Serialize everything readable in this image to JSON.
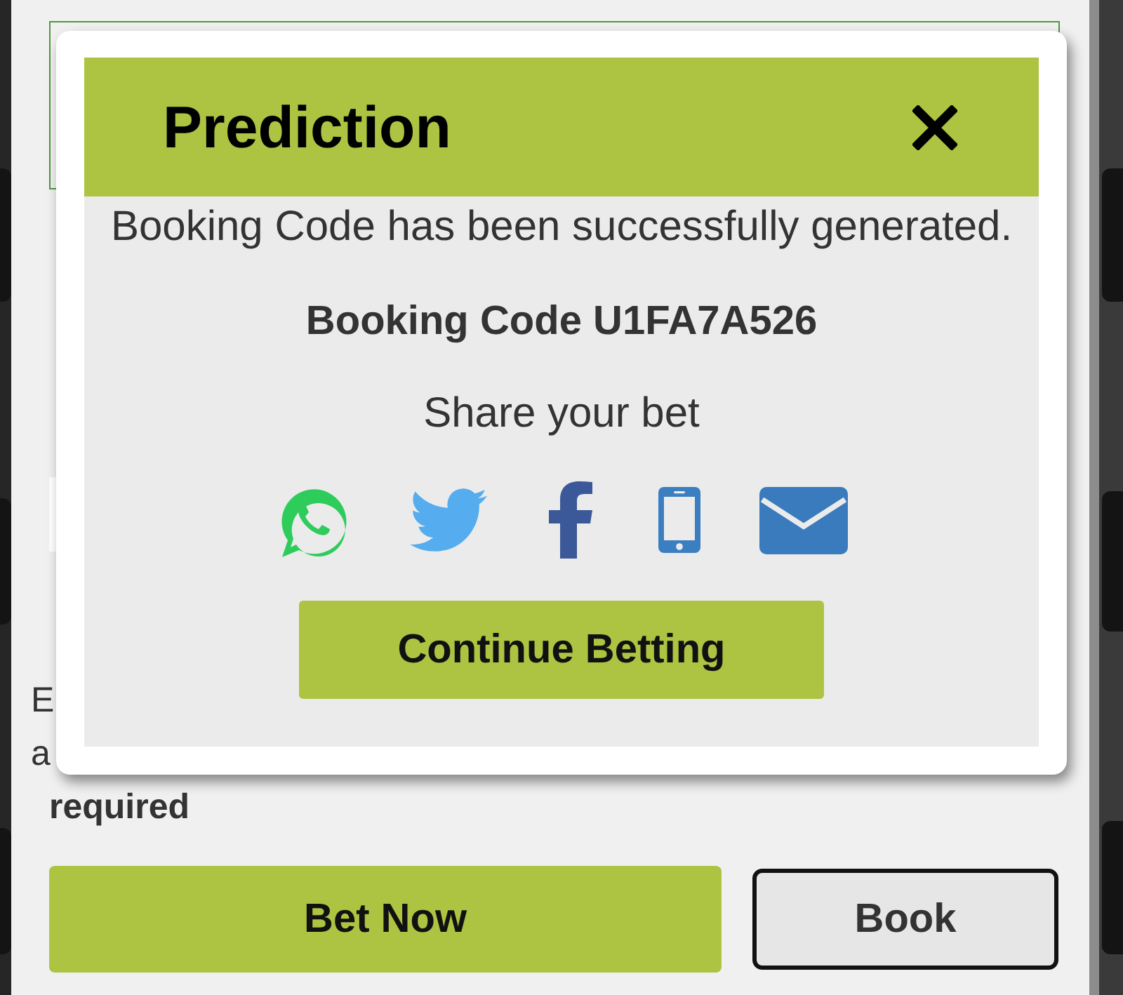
{
  "form": {
    "note_lines": [
      "E",
      "a"
    ],
    "required_note": "required",
    "buttons": [
      {
        "label": "Bet Now",
        "kind": "primary"
      },
      {
        "label": "Book",
        "kind": "secondary"
      }
    ]
  },
  "modal": {
    "title": "Prediction",
    "message": "Booking Code has been successfully generated.",
    "booking_code": "Booking Code U1FA7A526",
    "share_label": "Share your bet",
    "button": "Continue Betting"
  }
}
